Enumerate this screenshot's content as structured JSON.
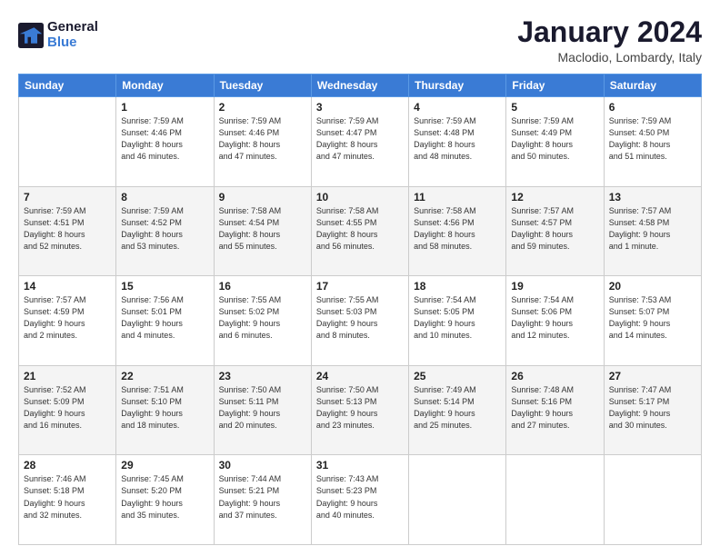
{
  "header": {
    "logo_line1": "General",
    "logo_line2": "Blue",
    "title": "January 2024",
    "subtitle": "Maclodio, Lombardy, Italy"
  },
  "weekdays": [
    "Sunday",
    "Monday",
    "Tuesday",
    "Wednesday",
    "Thursday",
    "Friday",
    "Saturday"
  ],
  "weeks": [
    [
      {
        "num": "",
        "info": ""
      },
      {
        "num": "1",
        "info": "Sunrise: 7:59 AM\nSunset: 4:46 PM\nDaylight: 8 hours\nand 46 minutes."
      },
      {
        "num": "2",
        "info": "Sunrise: 7:59 AM\nSunset: 4:46 PM\nDaylight: 8 hours\nand 47 minutes."
      },
      {
        "num": "3",
        "info": "Sunrise: 7:59 AM\nSunset: 4:47 PM\nDaylight: 8 hours\nand 47 minutes."
      },
      {
        "num": "4",
        "info": "Sunrise: 7:59 AM\nSunset: 4:48 PM\nDaylight: 8 hours\nand 48 minutes."
      },
      {
        "num": "5",
        "info": "Sunrise: 7:59 AM\nSunset: 4:49 PM\nDaylight: 8 hours\nand 50 minutes."
      },
      {
        "num": "6",
        "info": "Sunrise: 7:59 AM\nSunset: 4:50 PM\nDaylight: 8 hours\nand 51 minutes."
      }
    ],
    [
      {
        "num": "7",
        "info": "Sunrise: 7:59 AM\nSunset: 4:51 PM\nDaylight: 8 hours\nand 52 minutes."
      },
      {
        "num": "8",
        "info": "Sunrise: 7:59 AM\nSunset: 4:52 PM\nDaylight: 8 hours\nand 53 minutes."
      },
      {
        "num": "9",
        "info": "Sunrise: 7:58 AM\nSunset: 4:54 PM\nDaylight: 8 hours\nand 55 minutes."
      },
      {
        "num": "10",
        "info": "Sunrise: 7:58 AM\nSunset: 4:55 PM\nDaylight: 8 hours\nand 56 minutes."
      },
      {
        "num": "11",
        "info": "Sunrise: 7:58 AM\nSunset: 4:56 PM\nDaylight: 8 hours\nand 58 minutes."
      },
      {
        "num": "12",
        "info": "Sunrise: 7:57 AM\nSunset: 4:57 PM\nDaylight: 8 hours\nand 59 minutes."
      },
      {
        "num": "13",
        "info": "Sunrise: 7:57 AM\nSunset: 4:58 PM\nDaylight: 9 hours\nand 1 minute."
      }
    ],
    [
      {
        "num": "14",
        "info": "Sunrise: 7:57 AM\nSunset: 4:59 PM\nDaylight: 9 hours\nand 2 minutes."
      },
      {
        "num": "15",
        "info": "Sunrise: 7:56 AM\nSunset: 5:01 PM\nDaylight: 9 hours\nand 4 minutes."
      },
      {
        "num": "16",
        "info": "Sunrise: 7:55 AM\nSunset: 5:02 PM\nDaylight: 9 hours\nand 6 minutes."
      },
      {
        "num": "17",
        "info": "Sunrise: 7:55 AM\nSunset: 5:03 PM\nDaylight: 9 hours\nand 8 minutes."
      },
      {
        "num": "18",
        "info": "Sunrise: 7:54 AM\nSunset: 5:05 PM\nDaylight: 9 hours\nand 10 minutes."
      },
      {
        "num": "19",
        "info": "Sunrise: 7:54 AM\nSunset: 5:06 PM\nDaylight: 9 hours\nand 12 minutes."
      },
      {
        "num": "20",
        "info": "Sunrise: 7:53 AM\nSunset: 5:07 PM\nDaylight: 9 hours\nand 14 minutes."
      }
    ],
    [
      {
        "num": "21",
        "info": "Sunrise: 7:52 AM\nSunset: 5:09 PM\nDaylight: 9 hours\nand 16 minutes."
      },
      {
        "num": "22",
        "info": "Sunrise: 7:51 AM\nSunset: 5:10 PM\nDaylight: 9 hours\nand 18 minutes."
      },
      {
        "num": "23",
        "info": "Sunrise: 7:50 AM\nSunset: 5:11 PM\nDaylight: 9 hours\nand 20 minutes."
      },
      {
        "num": "24",
        "info": "Sunrise: 7:50 AM\nSunset: 5:13 PM\nDaylight: 9 hours\nand 23 minutes."
      },
      {
        "num": "25",
        "info": "Sunrise: 7:49 AM\nSunset: 5:14 PM\nDaylight: 9 hours\nand 25 minutes."
      },
      {
        "num": "26",
        "info": "Sunrise: 7:48 AM\nSunset: 5:16 PM\nDaylight: 9 hours\nand 27 minutes."
      },
      {
        "num": "27",
        "info": "Sunrise: 7:47 AM\nSunset: 5:17 PM\nDaylight: 9 hours\nand 30 minutes."
      }
    ],
    [
      {
        "num": "28",
        "info": "Sunrise: 7:46 AM\nSunset: 5:18 PM\nDaylight: 9 hours\nand 32 minutes."
      },
      {
        "num": "29",
        "info": "Sunrise: 7:45 AM\nSunset: 5:20 PM\nDaylight: 9 hours\nand 35 minutes."
      },
      {
        "num": "30",
        "info": "Sunrise: 7:44 AM\nSunset: 5:21 PM\nDaylight: 9 hours\nand 37 minutes."
      },
      {
        "num": "31",
        "info": "Sunrise: 7:43 AM\nSunset: 5:23 PM\nDaylight: 9 hours\nand 40 minutes."
      },
      {
        "num": "",
        "info": ""
      },
      {
        "num": "",
        "info": ""
      },
      {
        "num": "",
        "info": ""
      }
    ]
  ]
}
